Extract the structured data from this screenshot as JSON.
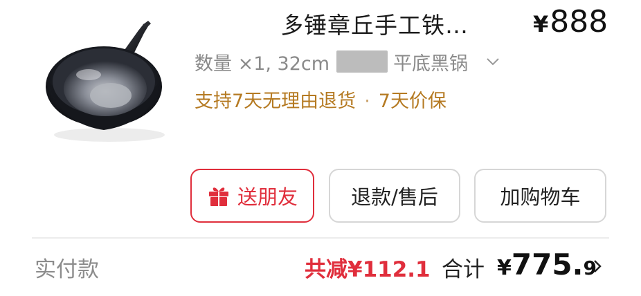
{
  "product": {
    "title": "多锤章丘手工铁…",
    "price_symbol": "¥",
    "price": "888",
    "spec_prefix": "数量 ×1, 32cm",
    "spec_suffix": "平底黑锅",
    "services": [
      "支持7天无理由退货",
      "7天价保"
    ],
    "service_separator": "·"
  },
  "actions": {
    "gift_label": "送朋友",
    "refund_label": "退款/售后",
    "cart_label": "加购物车"
  },
  "summary": {
    "paid_label": "实付款",
    "discount_text": "共减¥112.1",
    "total_label": "合计",
    "total_symbol": "¥",
    "total_int": "775.",
    "total_dec": "9"
  },
  "colors": {
    "accent_red": "#e02e3c",
    "service_gold": "#b57a22"
  },
  "icons": [
    "wok-product-image",
    "chevron-down-icon",
    "gift-icon",
    "chevron-right-icon"
  ]
}
